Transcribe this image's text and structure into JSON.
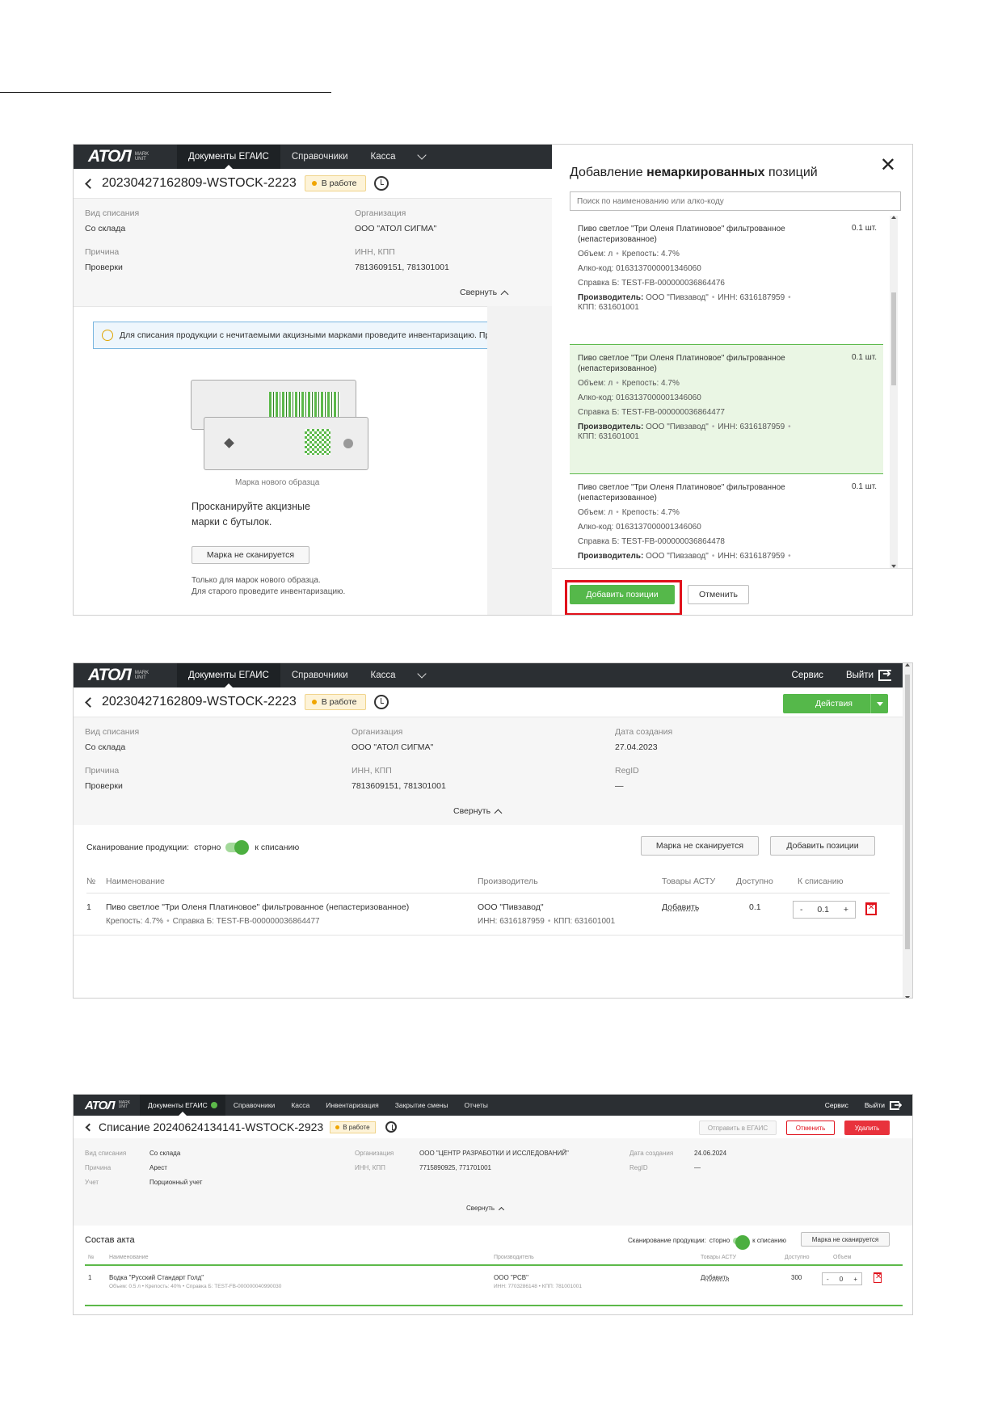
{
  "nav": {
    "logo": "ATOЛ",
    "logo_sub1": "MARK",
    "logo_sub2": "UNIT",
    "egais": "Документы ЕГАИС",
    "refs": "Справочники",
    "kassa": "Касса",
    "inventory": "Инвентаризация",
    "shift_close": "Закрытие смены",
    "reports": "Отчеты",
    "service": "Сервис",
    "logout": "Выйти"
  },
  "doc": {
    "title": "20230427162809-WSTOCK-2223",
    "status": "В работе",
    "actions": "Действия",
    "collapse": "Свернуть",
    "fields": {
      "type_k": "Вид списания",
      "type_v": "Со склада",
      "org_k": "Организация",
      "org_v": "ООО \"АТОЛ СИГМА\"",
      "reason_k": "Причина",
      "reason_v": "Проверки",
      "inn_k": "ИНН, КПП",
      "inn_v": "7813609151, 781301001",
      "date_k": "Дата создания",
      "date_v": "27.04.2023",
      "regid_k": "RegID",
      "regid_v": "—"
    }
  },
  "s1": {
    "tip": "Для списания продукции с нечитаемыми акцизными марками проведите инвентаризацию. Продукция",
    "stamp_caption": "Марка нового образца",
    "scan_line1": "Просканируйте акцизные",
    "scan_line2": "марки с бутылок.",
    "not_scanned_btn": "Марка не сканируется",
    "note_line1": "Только для марок нового образца.",
    "note_line2": "Для старого проведите инвентаризацию."
  },
  "modal": {
    "title_pre": "Добавление ",
    "title_bold": "немаркированных",
    "title_post": " позиций",
    "search_placeholder": "Поиск по наименованию или алко-коду",
    "labels": {
      "volume": "Объем: л",
      "strength": "Крепость: 4.7%",
      "alco": "Алко-код: 0163137000001346060",
      "producer_k": "Производитель:",
      "producer_v": "ООО \"Пивзавод\"",
      "inn": "ИНН: 6316187959",
      "kpp": "КПП: 631601001"
    },
    "items": [
      {
        "name": "Пиво светлое \"Три Оленя Платиновое\" фильтрованное (непастеризованное)",
        "qty": "0.1 шт.",
        "cert": "Справка Б: TEST-FB-000000036864476"
      },
      {
        "name": "Пиво светлое \"Три Оленя Платиновое\" фильтрованное (непастеризованное)",
        "qty": "0.1 шт.",
        "cert": "Справка Б: TEST-FB-000000036864477"
      },
      {
        "name": "Пиво светлое \"Три Оленя Платиновое\" фильтрованное (непастеризованное)",
        "qty": "0.1 шт.",
        "cert": "Справка Б: TEST-FB-000000036864478"
      }
    ],
    "add_btn": "Добавить позиции",
    "cancel_btn": "Отменить"
  },
  "s2": {
    "scan_label": "Сканирование продукции:",
    "storno": "сторно",
    "to_writeoff": "к списанию",
    "not_scanned_btn": "Марка не сканируется",
    "add_positions_btn": "Добавить позиции",
    "headers": {
      "num": "№",
      "name": "Наименование",
      "producer": "Производитель",
      "astu": "Товары АСТУ",
      "avail": "Доступно",
      "writeoff": "К списанию"
    },
    "row": {
      "num": "1",
      "name": "Пиво светлое \"Три Оленя Платиновое\" фильтрованное (непастеризованное)",
      "strength": "Крепость: 4.7%",
      "cert": "Справка Б: TEST-FB-000000036864477",
      "producer": "ООО \"Пивзавод\"",
      "inn": "ИНН: 6316187959",
      "kpp": "КПП: 631601001",
      "add": "Добавить",
      "avail": "0.1",
      "qty": "0.1",
      "minus": "-",
      "plus": "+"
    }
  },
  "s3": {
    "title": "Списание 20240624134141-WSTOCK-2923",
    "status": "В работе",
    "send_btn": "Отправить в ЕГАИС",
    "cancel_btn": "Отменить",
    "delete_btn": "Удалить",
    "f": {
      "type_k": "Вид списания",
      "type_v": "Со склада",
      "reason_k": "Причина",
      "reason_v": "Арест",
      "acc_k": "Учет",
      "acc_v": "Порционный учет",
      "org_k": "Организация",
      "org_v": "ООО \"ЦЕНТР РАЗРАБОТКИ И ИССЛЕДОВАНИЙ\"",
      "inn_k": "ИНН, КПП",
      "inn_v": "7715890925, 771701001",
      "date_k": "Дата создания",
      "date_v": "24.06.2024",
      "regid_k": "RegID",
      "regid_v": "—"
    },
    "collapse": "Свернуть",
    "act": "Состав акта",
    "scan_label": "Сканирование продукции:",
    "storno": "сторно",
    "to_writeoff": "к списанию",
    "not_scanned_btn": "Марка не сканируется",
    "headers": {
      "num": "№",
      "name": "Наименование",
      "producer": "Производитель",
      "astu": "Товары АСТУ",
      "avail": "Доступно",
      "volume": "Объем"
    },
    "row": {
      "num": "1",
      "name": "Водка \"Русский Стандарт Голд\"",
      "sub": "Объем: 0.5 л  •  Крепость: 40%  •  Справка Б: TEST-FB-000000040990030",
      "producer": "ООО \"РСВ\"",
      "producer_sub": "ИНН: 7703286148  •  КПП: 781001001",
      "add": "Добавить",
      "avail": "300",
      "qty": "0",
      "minus": "-",
      "plus": "+"
    }
  }
}
